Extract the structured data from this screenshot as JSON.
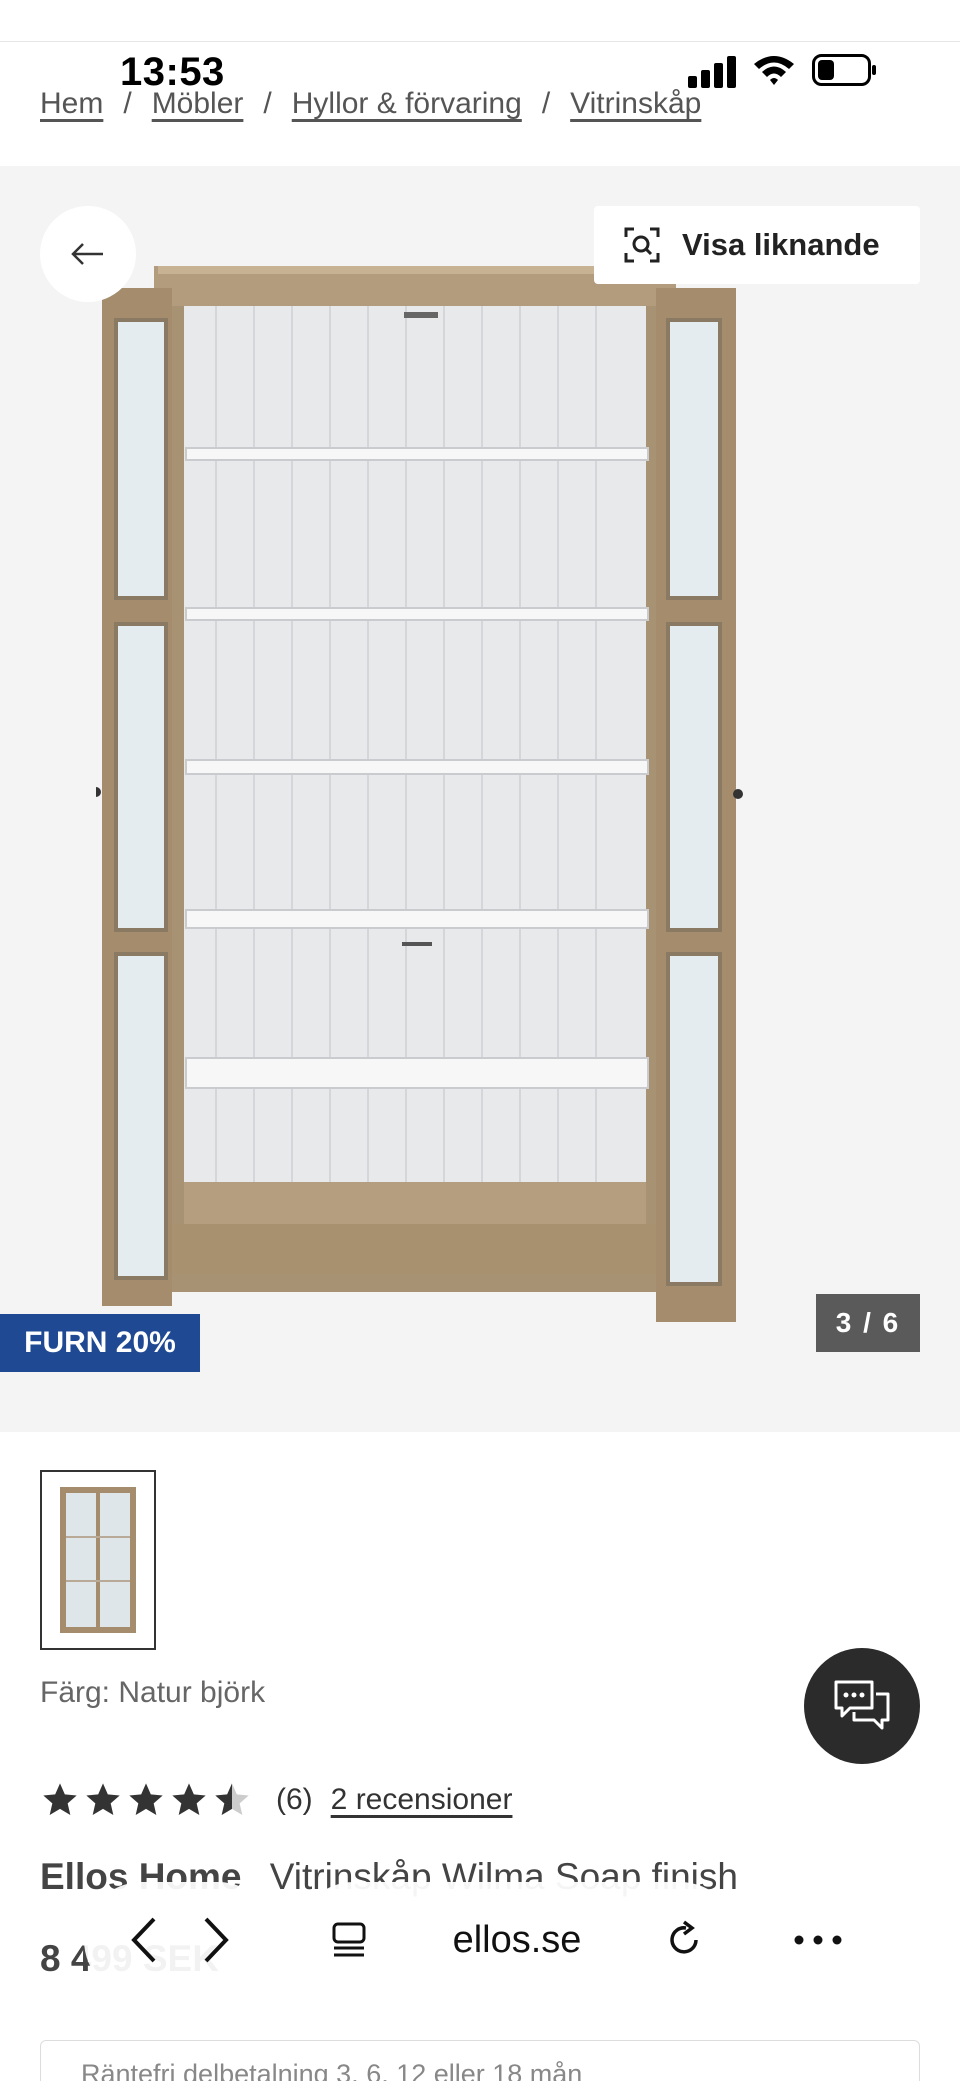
{
  "status_bar": {
    "time": "13:53"
  },
  "breadcrumb": {
    "items": [
      "Hem",
      "Möbler",
      "Hyllor & förvaring",
      "Vitrinskåp"
    ],
    "separator": "/"
  },
  "gallery": {
    "similar_label": "Visa liknande",
    "promo_badge": "FURN 20%",
    "counter": "3 / 6"
  },
  "product": {
    "color_label": "Färg: Natur björk",
    "rating": {
      "value": 4.5,
      "max": 5,
      "count": "(6)",
      "reviews_link": "2 recensioner"
    },
    "brand": "Ellos Home",
    "name": "Vitrinskåp Wilma Soap finish",
    "price": "8 499 SEK",
    "installment_text": "Räntefri delbetalning 3, 6, 12 eller 18 mån"
  },
  "browser": {
    "url": "ellos.se"
  },
  "colors": {
    "promo": "#1f4a93",
    "counter_bg": "#5a5a5a",
    "chat_bg": "#2b2b2b",
    "star": "#333333"
  },
  "icons": [
    "back-arrow-icon",
    "visual-search-icon",
    "chat-icon",
    "star-icon",
    "chevron-left-icon",
    "chevron-right-icon",
    "reader-mode-icon",
    "reload-icon",
    "more-icon"
  ]
}
